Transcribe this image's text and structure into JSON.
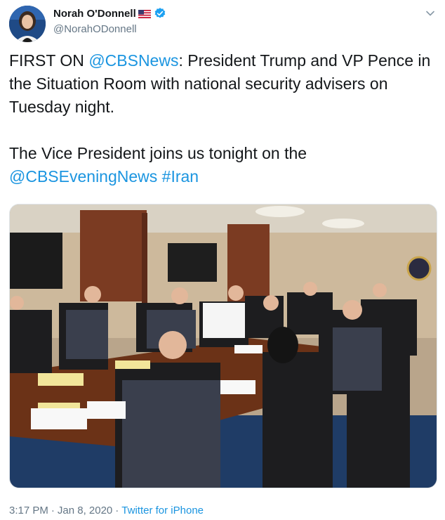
{
  "author": {
    "display_name": "Norah O'Donnell",
    "handle": "@NorahODonnell",
    "flag_icon": "us-flag-icon",
    "verified_icon": "verified-badge-icon"
  },
  "tweet": {
    "lead": "FIRST ON ",
    "mention_cbs": "@CBSNews",
    "body_1": ": President Trump and VP Pence in the Situation Room with national security advisers on Tuesday night.",
    "body_2": "The Vice President joins us tonight on the",
    "mention_evening": "@CBSEveningNews",
    "hashtag": "#Iran"
  },
  "meta": {
    "time": "3:17 PM",
    "separator_1": "·",
    "date": "Jan 8, 2020",
    "separator_2": "·",
    "source": "Twitter for iPhone"
  },
  "colors": {
    "link": "#1b95e0",
    "muted": "#657786",
    "text": "#14171a"
  }
}
